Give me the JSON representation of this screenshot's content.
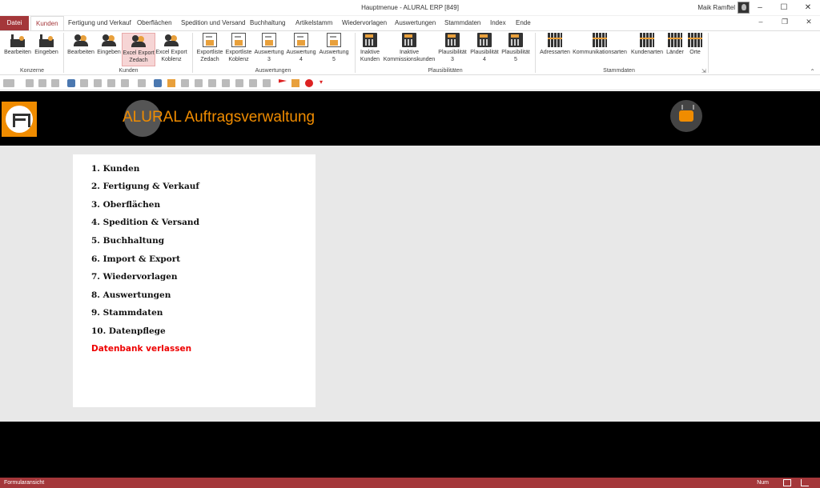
{
  "window": {
    "title": "Hauptmenue  -  ALURAL ERP [849]",
    "user": "Maik Ramftel",
    "minimize": "–",
    "maximize": "☐",
    "restore": "❐",
    "close": "✕"
  },
  "menu": {
    "tabs": [
      "Datei",
      "Kunden",
      "Fertigung und Verkauf",
      "Oberflächen",
      "Spedition und Versand",
      "Buchhaltung",
      "Artikelstamm",
      "Wiedervorlagen",
      "Auswertungen",
      "Stammdaten",
      "Index",
      "Ende"
    ]
  },
  "ribbon": {
    "groups": {
      "konzerne": "Konzerne",
      "kunden": "Kunden",
      "auswertungen": "Auswertungen",
      "plausibilitaeten": "Plausibilitäten",
      "stammdaten": "Stammdaten"
    },
    "buttons": {
      "k_bearbeiten": "Bearbeiten",
      "k_eingeben": "Eingeben",
      "c_bearbeiten": "Bearbeiten",
      "c_eingeben": "Eingeben",
      "excel_zedach_1": "Excel Export",
      "excel_zedach_2": "Zedach",
      "excel_koblenz_1": "Excel Export",
      "excel_koblenz_2": "Koblenz",
      "exp_zedach_1": "Exportliste",
      "exp_zedach_2": "Zedach",
      "exp_koblenz_1": "Exportliste",
      "exp_koblenz_2": "Koblenz",
      "ausw3_1": "Auswertung",
      "ausw3_2": "3",
      "ausw4_1": "Auswertung",
      "ausw4_2": "4",
      "ausw5_1": "Auswertung",
      "ausw5_2": "5",
      "inaktiv_k_1": "Inaktive",
      "inaktiv_k_2": "Kunden",
      "inaktiv_kk_1": "Inaktive",
      "inaktiv_kk_2": "Kommissionskunden",
      "plaus3_1": "Plausibilität",
      "plaus3_2": "3",
      "plaus4_1": "Plausibilität",
      "plaus4_2": "4",
      "plaus5_1": "Plausibilität",
      "plaus5_2": "5",
      "adressarten": "Adressarten",
      "kommunikationsarten": "Kommunikationsarten",
      "kundenarten": "Kundenarten",
      "laender": "Länder",
      "orte": "Orte"
    }
  },
  "header": {
    "title": "ALURAL Auftragsverwaltung"
  },
  "main_menu": [
    "1. Kunden",
    "2. Fertigung & Verkauf",
    "3. Oberflächen",
    "4. Spedition & Versand",
    "5. Buchhaltung",
    "6. Import & Export",
    "7. Wiedervorlagen",
    "8. Auswertungen",
    "9. Stammdaten",
    "10. Datenpflege"
  ],
  "exit_label": "Datenbank verlassen",
  "status": {
    "left": "Formularansicht",
    "num": "Num"
  },
  "colors": {
    "accent": "#a4373a",
    "orange": "#f08c00",
    "exit": "#e00000"
  }
}
